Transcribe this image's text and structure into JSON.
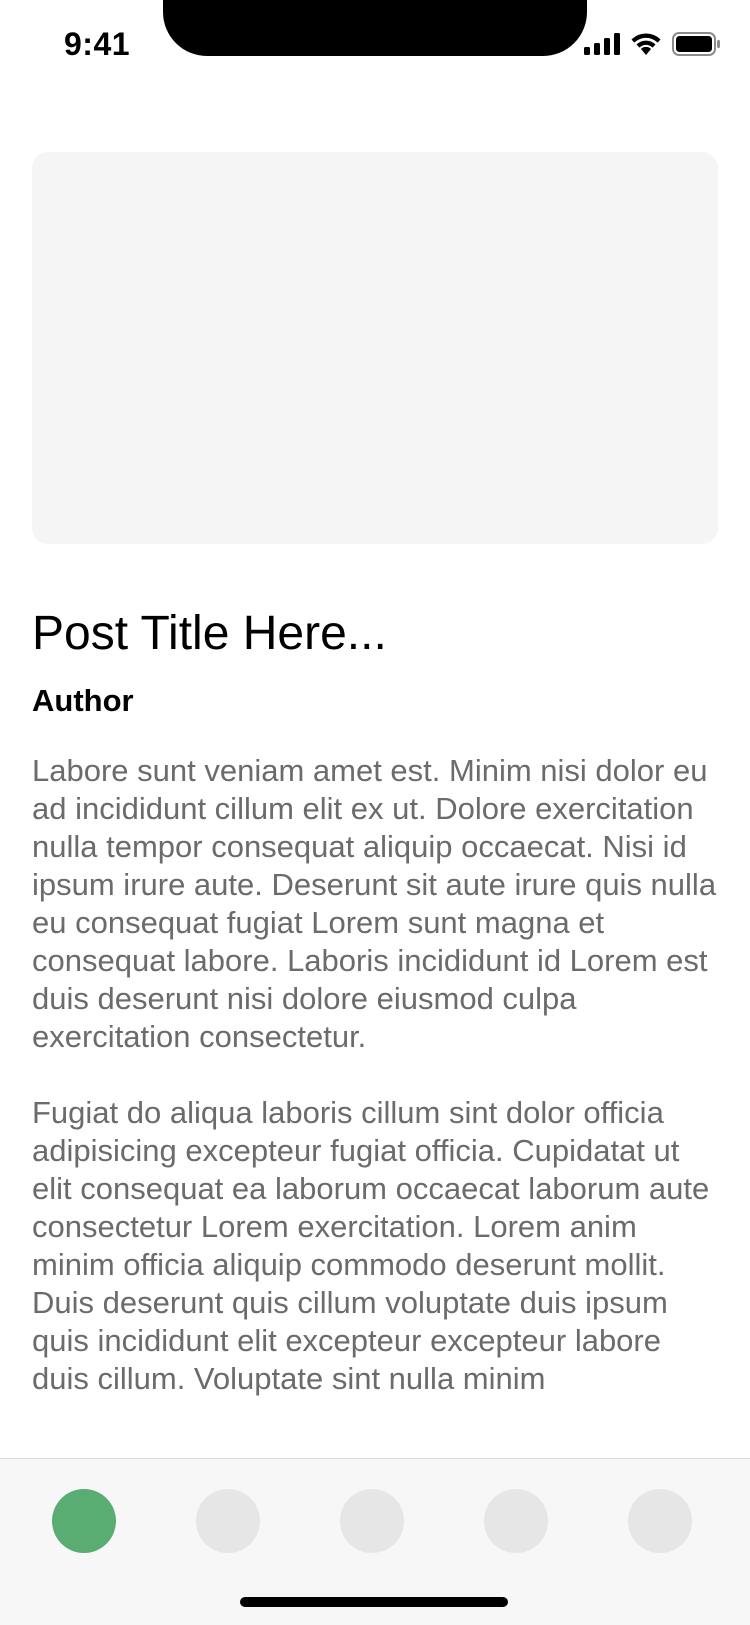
{
  "status_bar": {
    "time": "9:41",
    "icons": [
      "cellular-signal-icon",
      "wifi-icon",
      "battery-icon"
    ]
  },
  "post": {
    "image": "image-placeholder",
    "title": "Post Title Here...",
    "author": "Author",
    "paragraphs": [
      "Labore sunt veniam amet est. Minim nisi dolor eu ad incididunt cillum elit ex ut. Dolore exercitation nulla tempor consequat aliquip occaecat. Nisi id ipsum irure aute. Deserunt sit aute irure quis nulla eu consequat fugiat Lorem sunt magna et consequat labore. Laboris incididunt id Lorem est duis deserunt nisi dolore eiusmod culpa exercitation consectetur.",
      "Fugiat do aliqua laboris cillum sint dolor officia adipisicing excepteur fugiat officia. Cupidatat ut elit consequat ea laborum occaecat laborum aute consectetur Lorem exercitation. Lorem anim minim officia aliquip commodo deserunt mollit. Duis deserunt quis cillum voluptate duis ipsum quis incididunt elit excepteur excepteur labore duis cillum. Voluptate sint nulla minim"
    ]
  },
  "tab_bar": {
    "active_index": 0,
    "active_color": "#5aad72",
    "inactive_color": "#e6e6e6",
    "tabs": [
      "tab-1",
      "tab-2",
      "tab-3",
      "tab-4",
      "tab-5"
    ]
  }
}
